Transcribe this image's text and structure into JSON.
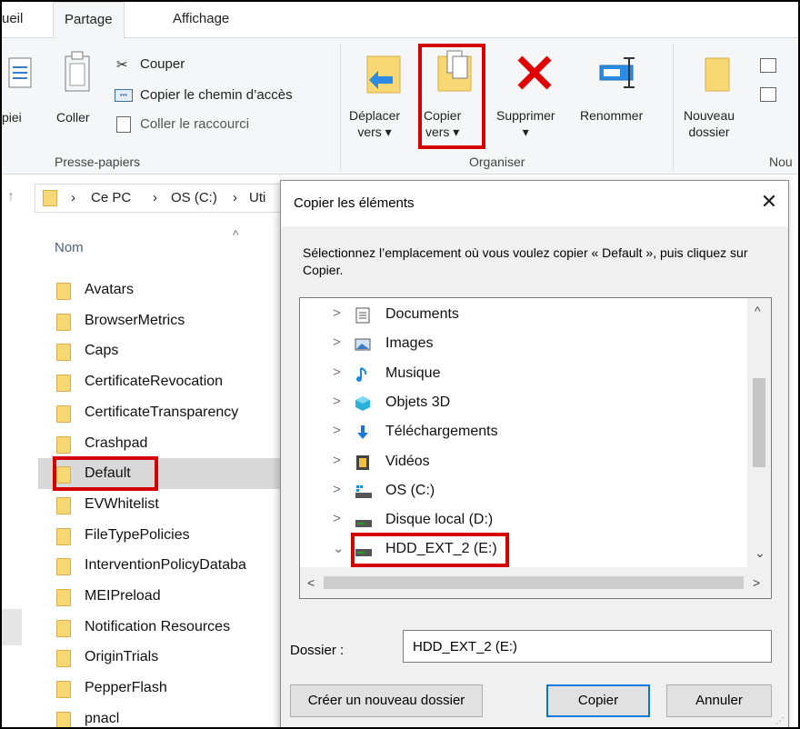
{
  "ribbon": {
    "tabs": [
      "ueil",
      "Partage",
      "Affichage"
    ],
    "clipboard": {
      "copy_label_partial": "piei",
      "paste_label": "Coller",
      "cut_label": "Couper",
      "copy_path_label": "Copier le chemin d’accès",
      "paste_shortcut_label": "Coller le raccourci",
      "group_label": "Presse-papiers"
    },
    "organise": {
      "move_to_label": "Déplacer\nvers ▾",
      "copy_to_label": "Copier\nvers ▾",
      "delete_label": "Supprimer\n▾",
      "rename_label": "Renommer",
      "group_label": "Organiser"
    },
    "new": {
      "new_folder_label": "Nouveau\ndossier",
      "group_label_partial": "Nou"
    }
  },
  "address": {
    "crumbs": [
      "Ce PC",
      "OS (C:)",
      "Uti"
    ],
    "sep": "›"
  },
  "file_list": {
    "column_header": "Nom",
    "items": [
      "Avatars",
      "BrowserMetrics",
      "Caps",
      "CertificateRevocation",
      "CertificateTransparency",
      "Crashpad",
      "Default",
      "EVWhitelist",
      "FileTypePolicies",
      "InterventionPolicyDataba",
      "MEIPreload",
      "Notification Resources",
      "OriginTrials",
      "PepperFlash",
      "pnacl"
    ],
    "selected_index": 6
  },
  "dialog": {
    "title": "Copier les éléments",
    "instruction": "Sélectionnez l’emplacement où vous voulez copier « Default », puis cliquez sur Copier.",
    "tree": [
      {
        "label": "Documents",
        "icon": "documents-icon",
        "chevron": ">"
      },
      {
        "label": "Images",
        "icon": "images-icon",
        "chevron": ">"
      },
      {
        "label": "Musique",
        "icon": "music-icon",
        "chevron": ">"
      },
      {
        "label": "Objets 3D",
        "icon": "objects-3d-icon",
        "chevron": ">"
      },
      {
        "label": "Téléchargements",
        "icon": "download-icon",
        "chevron": ">"
      },
      {
        "label": "Vidéos",
        "icon": "videos-icon",
        "chevron": ">"
      },
      {
        "label": "OS (C:)",
        "icon": "system-drive-icon",
        "chevron": ">"
      },
      {
        "label": "Disque local (D:)",
        "icon": "drive-icon",
        "chevron": ">"
      },
      {
        "label": "HDD_EXT_2 (E:)",
        "icon": "drive-icon",
        "chevron": "⌄"
      }
    ],
    "folder_label": "Dossier :",
    "folder_value": "HDD_EXT_2 (E:)",
    "new_folder_button": "Créer un nouveau dossier",
    "copy_button": "Copier",
    "cancel_button": "Annuler"
  },
  "colors": {
    "highlight": "#d40000",
    "folder": "#f8d775",
    "primary_border": "#0078d7"
  }
}
